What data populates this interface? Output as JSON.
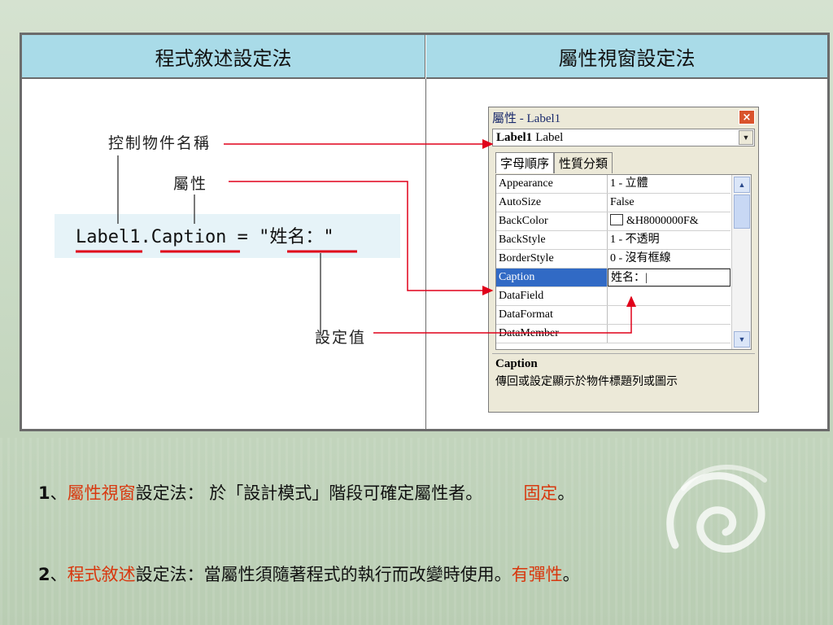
{
  "table": {
    "header_left": "程式敘述設定法",
    "header_right": "屬性視窗設定法"
  },
  "code": {
    "line": "Label1.Caption = \"姓名：\""
  },
  "annotations": {
    "object_name": "控制物件名稱",
    "property": "屬性",
    "value": "設定值"
  },
  "properties_window": {
    "title": "屬性 - Label1",
    "close_glyph": "×",
    "combo_bold": "Label1",
    "combo_type": "Label",
    "tab_alpha": "字母順序",
    "tab_category": "性質分類",
    "rows": [
      {
        "name": "Appearance",
        "value": "1 - 立體"
      },
      {
        "name": "AutoSize",
        "value": "False"
      },
      {
        "name": "BackColor",
        "value": "&H8000000F&"
      },
      {
        "name": "BackStyle",
        "value": "1 - 不透明"
      },
      {
        "name": "BorderStyle",
        "value": "0 - 沒有框線"
      },
      {
        "name": "Caption",
        "value": "姓名：|"
      },
      {
        "name": "DataField",
        "value": ""
      },
      {
        "name": "DataFormat",
        "value": ""
      },
      {
        "name": "DataMember",
        "value": ""
      }
    ],
    "desc_title": "Caption",
    "desc_text": "傳回或設定顯示於物件標題列或圖示"
  },
  "notes": {
    "line1": {
      "num": "1",
      "sep": "、",
      "red1": "屬性視窗",
      "text1": "設定法： 於「設計模式」階段可確定屬性者。",
      "red2": "固定",
      "end": "。"
    },
    "line2": {
      "num": "2",
      "sep": "、",
      "red1": "程式敘述",
      "text1": "設定法：當屬性須隨著程式的執行而改變時使用。",
      "red2": "有彈性",
      "end": "。"
    }
  },
  "colors": {
    "header_bg": "#a9dbe8",
    "accent_red": "#d8380f",
    "arrow_red": "#e0001a",
    "selection_blue": "#316ac5"
  }
}
